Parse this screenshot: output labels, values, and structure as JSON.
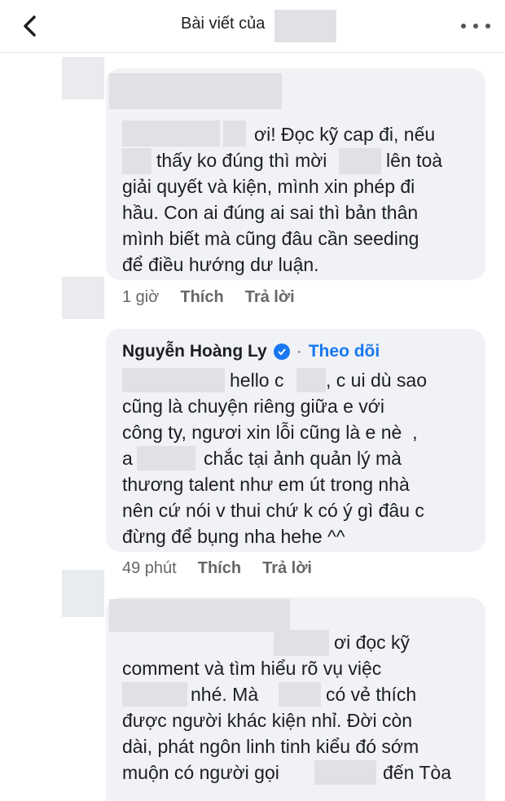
{
  "header": {
    "title": "Bài viết của",
    "back_icon": "chevron-left-icon",
    "more_icon": "more-horizontal-icon"
  },
  "comments": [
    {
      "lines": [
        "ơi! Đọc kỹ cap đi, nếu",
        "thấy ko đúng thì mời",
        "lên toà",
        "giải quyết và kiện, mình xin phép đi",
        "hầu. Con ai đúng ai sai thì bản thân",
        "mình biết mà cũng đâu cần seeding",
        "để điều hướng dư luận."
      ],
      "time": "1 giờ",
      "like": "Thích",
      "reply": "Trả lời"
    },
    {
      "author": "Nguyễn Hoàng Ly",
      "follow": "Theo dõi",
      "separator": "·",
      "lines": [
        "hello c",
        ", c ui dù sao",
        "cũng là chuyện riêng giữa e với",
        "công ty, ngươi xin lỗi cũng là e nè  ,",
        "a",
        "chắc tại ảnh quản lý mà",
        "thương talent như em út trong nhà",
        "nên cứ nói v thui chứ k có ý gì đâu c",
        "đừng để bụng nha hehe ^^"
      ],
      "time": "49 phút",
      "like": "Thích",
      "reply": "Trả lời"
    },
    {
      "lines": [
        "ơi đọc kỹ",
        "comment và tìm hiểu rõ vụ việc",
        "nhé. Mà",
        "có vẻ thích",
        "được người khác kiện nhỉ. Đời còn",
        "dài, phát ngôn linh tinh kiểu đó sớm",
        "muộn có người gọi",
        "đến Tòa"
      ]
    }
  ],
  "colors": {
    "bubble": "#f0f2f5",
    "link": "#1877f2",
    "meta": "#65676b",
    "blur": "#dfe1e5"
  }
}
